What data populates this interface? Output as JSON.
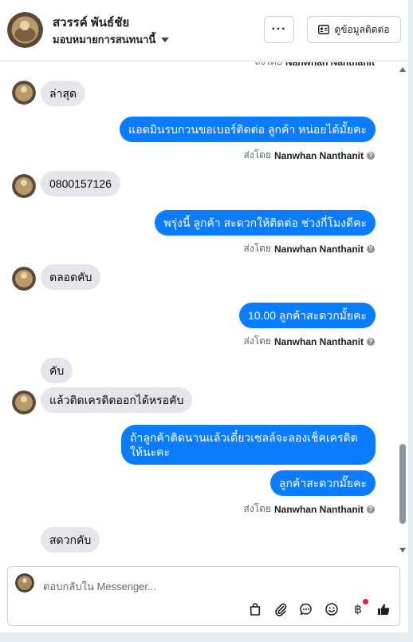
{
  "header": {
    "contact_name": "สวรรค์ พันธ์ชัย",
    "assignment": "มอบหมายการสนทนานี้",
    "more_label": "···",
    "contact_info_label": "ดูข้อมูลติดต่อ"
  },
  "thread": {
    "sentby_prefix": "ส่งโดย",
    "sender_name": "Nanwhan Nanthanit",
    "info_glyph": "?",
    "messages": [
      {
        "direction": "in",
        "text": "ล่าสุด"
      },
      {
        "direction": "out",
        "text": "แอดมินรบกวนขอเบอร์ติดต่อ ลูกค้า หน่อยได้มั้ยคะ"
      },
      {
        "direction": "in",
        "text": "0800157126"
      },
      {
        "direction": "out",
        "text": "พรุ่งนี้ ลูกค้า สะดวกให้ติดต่อ ช่วงกี่โมงดีคะ"
      },
      {
        "direction": "in",
        "text": "ตลอดคับ"
      },
      {
        "direction": "out",
        "text": "10.00 ลูกค้าสะดวกมั้ยคะ"
      },
      {
        "direction": "in",
        "text": "คับ"
      },
      {
        "direction": "in",
        "text": "แล้วติดเครดิตออกได้หรอคับ"
      },
      {
        "direction": "out",
        "text": "ถ้าลูกค้าติดนานแล้วเดี๋ยวเซลล์จะลองเช็คเครดิตให้นะคะ"
      },
      {
        "direction": "out",
        "text": "ลูกค้าสะดวกมั๊ยคะ"
      },
      {
        "direction": "in",
        "text": "สดวกคับ"
      }
    ]
  },
  "composer": {
    "placeholder": "ตอบกลับใน Messenger...",
    "tools": [
      "shopping-bag-icon",
      "paperclip-icon",
      "chat-bubble-icon",
      "smiley-icon",
      "baht-icon",
      "thumbs-up-icon"
    ],
    "baht_glyph": "฿"
  },
  "colors": {
    "outgoing_bubble": "#0a7cff",
    "incoming_bubble": "#e4e6eb",
    "notification_dot": "#e41e3f"
  }
}
